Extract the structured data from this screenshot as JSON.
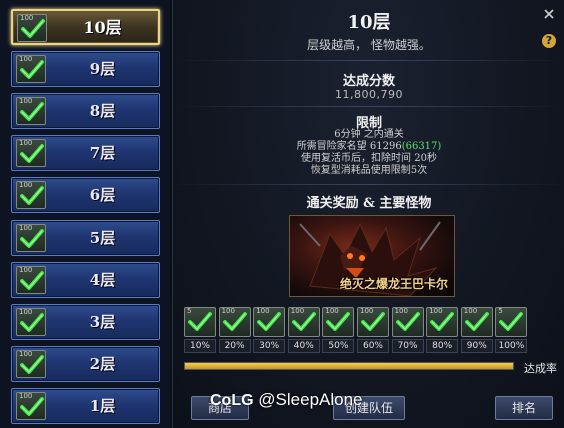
{
  "floors": [
    {
      "label": "10层",
      "icon_level": "100",
      "cleared": true,
      "selected": true
    },
    {
      "label": "9层",
      "icon_level": "100",
      "cleared": true,
      "selected": false
    },
    {
      "label": "8层",
      "icon_level": "100",
      "cleared": true,
      "selected": false
    },
    {
      "label": "7层",
      "icon_level": "100",
      "cleared": true,
      "selected": false
    },
    {
      "label": "6层",
      "icon_level": "100",
      "cleared": true,
      "selected": false
    },
    {
      "label": "5层",
      "icon_level": "100",
      "cleared": true,
      "selected": false
    },
    {
      "label": "4层",
      "icon_level": "100",
      "cleared": true,
      "selected": false
    },
    {
      "label": "3层",
      "icon_level": "100",
      "cleared": true,
      "selected": false
    },
    {
      "label": "2层",
      "icon_level": "100",
      "cleared": true,
      "selected": false
    },
    {
      "label": "1层",
      "icon_level": "100",
      "cleared": true,
      "selected": false
    }
  ],
  "panel": {
    "title": "10层",
    "subtitle": "层级越高，  怪物越强。",
    "score": {
      "heading": "达成分数",
      "value": "11,800,790"
    },
    "limits": {
      "heading": "限制",
      "time": "6分钟 之内通关",
      "fame_prefix": "所需冒险家名望 61296",
      "fame_current": "(66317)",
      "revive": "使用复活币后，扣除时间 20秒",
      "consumable": "恢复型消耗品使用限制5次"
    },
    "reward_heading": "通关奖励 & 主要怪物",
    "boss_name": "绝灭之爆龙王巴卡尔",
    "rewards": [
      {
        "pct": "10%",
        "icon_level": "5",
        "claimed": true
      },
      {
        "pct": "20%",
        "icon_level": "100",
        "claimed": true
      },
      {
        "pct": "30%",
        "icon_level": "100",
        "claimed": true
      },
      {
        "pct": "40%",
        "icon_level": "100",
        "claimed": true
      },
      {
        "pct": "50%",
        "icon_level": "100",
        "claimed": true
      },
      {
        "pct": "60%",
        "icon_level": "100",
        "claimed": true
      },
      {
        "pct": "70%",
        "icon_level": "100",
        "claimed": true
      },
      {
        "pct": "80%",
        "icon_level": "100",
        "claimed": true
      },
      {
        "pct": "90%",
        "icon_level": "100",
        "claimed": true
      },
      {
        "pct": "100%",
        "icon_level": "5",
        "claimed": true
      }
    ],
    "progress": {
      "label": "达成率",
      "fraction": 1.0
    },
    "buttons": {
      "shop": "商店",
      "create_party": "创建队伍",
      "ranking": "排名"
    },
    "watermark": {
      "logo": "CoLG",
      "handle": "@SleepAlone"
    }
  },
  "colors": {
    "accent_gold": "#e9d48a",
    "check_green": "#3ee24a",
    "floor_blue": "#1f3672",
    "progress_gold": "#f4cf52"
  }
}
